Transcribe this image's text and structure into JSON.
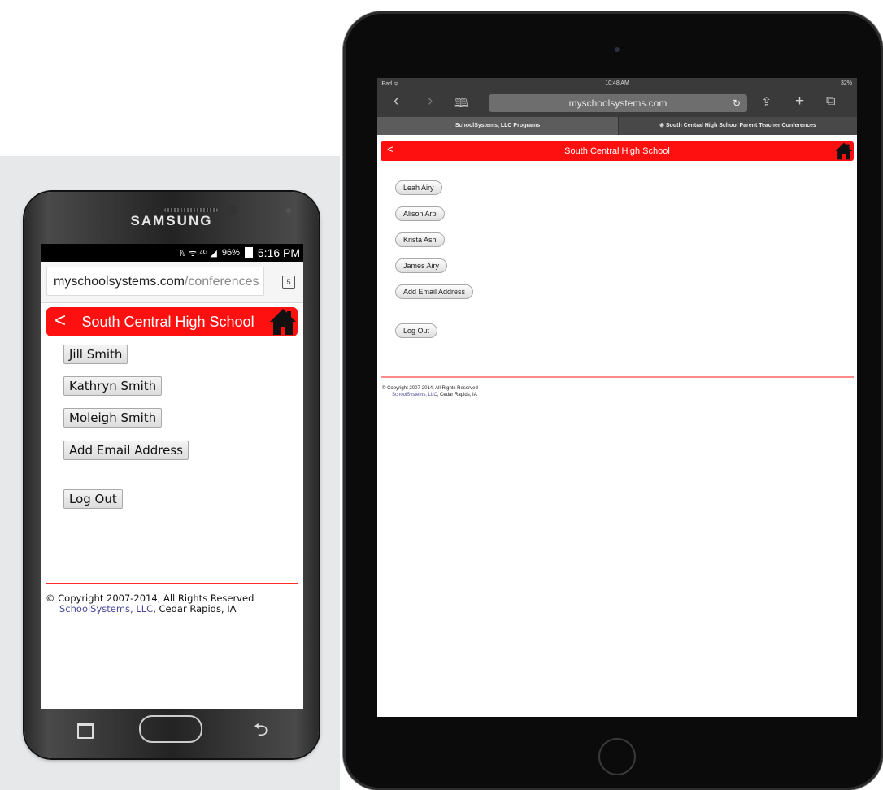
{
  "phone": {
    "brand": "SAMSUNG",
    "status": {
      "icons": "ℕ ᯤ ⁴ᴳ ◢",
      "battery": "96%",
      "time": "5:16 PM"
    },
    "url": {
      "domain": "myschoolsystems.com",
      "path": "/conferences"
    },
    "tab_count": "5",
    "header": {
      "back": "<",
      "title": "South Central High School"
    },
    "buttons": [
      "Jill Smith",
      "Kathryn Smith",
      "Moleigh Smith",
      "Add Email Address",
      "Log Out"
    ],
    "footer": {
      "copyright": "© Copyright 2007-2014, All Rights Reserved",
      "company_link": "SchoolSystems, LLC",
      "location": ", Cedar Rapids, IA"
    }
  },
  "ipad": {
    "status": {
      "left": "iPad ᯤ",
      "time": "10:48 AM",
      "battery": "32%"
    },
    "url": "myschoolsystems.com",
    "tabs": [
      "SchoolSystems, LLC Programs",
      "⊗   South Central High School Parent Teacher Conferences"
    ],
    "header": {
      "back": "<",
      "title": "South Central High School"
    },
    "buttons": [
      "Leah Airy",
      "Alison Arp",
      "Krista Ash",
      "James Airy",
      "Add Email Address",
      "Log Out"
    ],
    "footer": {
      "copyright": "© Copyright 2007-2014, All Rights Reserved",
      "company_link": "SchoolSystems, LLC",
      "location": ", Cedar Rapids, IA"
    }
  },
  "colors": {
    "header_red": "#ff1010",
    "rule_red": "#ff2a2a",
    "link": "#4a4a9a"
  }
}
